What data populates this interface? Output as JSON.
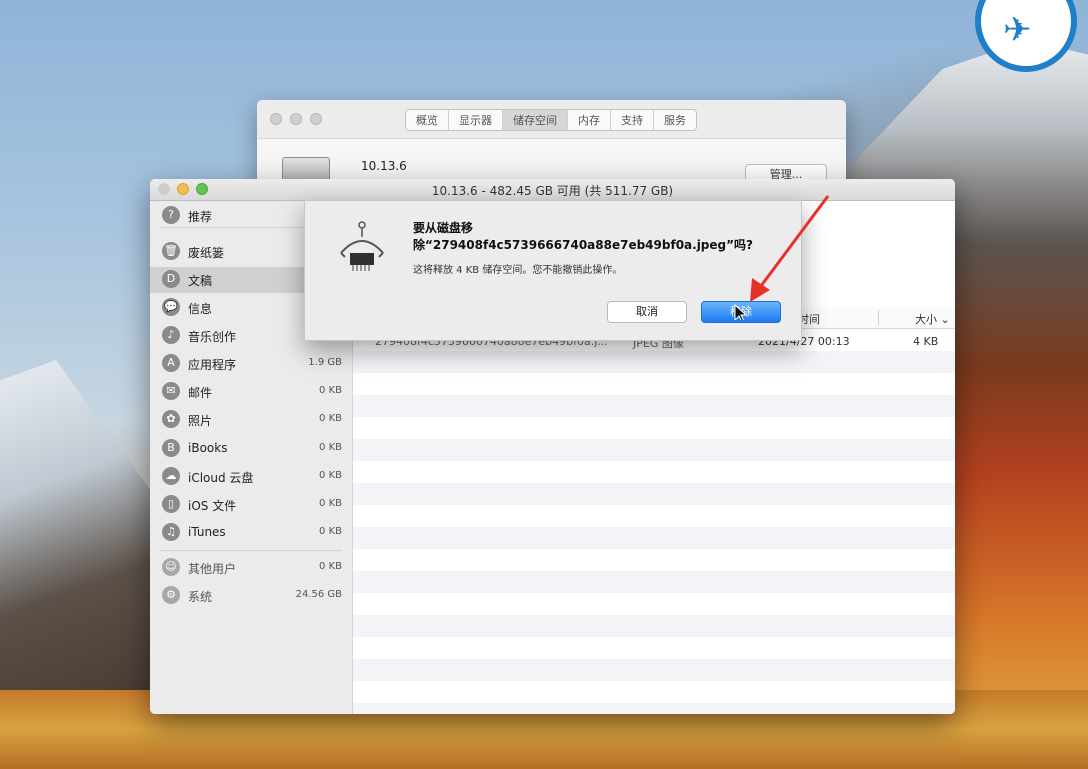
{
  "background_window": {
    "tabs": [
      "概览",
      "显示器",
      "储存空间",
      "内存",
      "支持",
      "服务"
    ],
    "active_tab": 2,
    "os_version": "10.13.6",
    "manage_button": "管理..."
  },
  "main_window": {
    "title": "10.13.6 - 482.45 GB 可用 (共 511.77 GB)"
  },
  "sidebar": {
    "items": [
      {
        "label": "推荐",
        "size": "",
        "icon": "lightbulb-icon",
        "glyph": "?",
        "selected": false
      },
      {
        "label": "废纸篓",
        "size": "",
        "icon": "trash-icon",
        "glyph": "🗑",
        "selected": false
      },
      {
        "label": "文稿",
        "size": "",
        "icon": "document-icon",
        "glyph": "D",
        "selected": true
      },
      {
        "label": "信息",
        "size": "",
        "icon": "messages-icon",
        "glyph": "💬",
        "selected": false
      },
      {
        "label": "音乐创作",
        "size": "",
        "icon": "guitar-icon",
        "glyph": "♪",
        "selected": false
      },
      {
        "label": "应用程序",
        "size": "1.9 GB",
        "icon": "applications-icon",
        "glyph": "A",
        "selected": false
      },
      {
        "label": "邮件",
        "size": "0 KB",
        "icon": "mail-icon",
        "glyph": "✉",
        "selected": false
      },
      {
        "label": "照片",
        "size": "0 KB",
        "icon": "photos-icon",
        "glyph": "✿",
        "selected": false
      },
      {
        "label": "iBooks",
        "size": "0 KB",
        "icon": "ibooks-icon",
        "glyph": "B",
        "selected": false
      },
      {
        "label": "iCloud 云盘",
        "size": "0 KB",
        "icon": "cloud-icon",
        "glyph": "☁",
        "selected": false
      },
      {
        "label": "iOS 文件",
        "size": "0 KB",
        "icon": "phone-icon",
        "glyph": "▯",
        "selected": false
      },
      {
        "label": "iTunes",
        "size": "0 KB",
        "icon": "itunes-icon",
        "glyph": "♫",
        "selected": false
      }
    ],
    "other_items": [
      {
        "label": "其他用户",
        "size": "0 KB",
        "icon": "users-icon",
        "glyph": "☺"
      },
      {
        "label": "系统",
        "size": "24.56 GB",
        "icon": "gear-icon",
        "glyph": "⚙"
      }
    ]
  },
  "table": {
    "col_time": "时间",
    "col_size": "大小 ⌄",
    "row": {
      "name": "279408f4c5739666740a88e7eb49bf0a.j...",
      "kind": "JPEG 图像",
      "date": "2021/4/27 00:13",
      "size": "4 KB"
    }
  },
  "dialog": {
    "title_line1": "要从磁盘移",
    "title_line2": "除“279408f4c5739666740a88e7eb49bf0a.jpeg”吗?",
    "description": "这将释放 4 KB 储存空间。您不能撤销此操作。",
    "cancel_label": "取消",
    "remove_label": "移除"
  },
  "colors": {
    "accent_blue": "#1d7cf2",
    "annotation_red": "#e8302a"
  }
}
